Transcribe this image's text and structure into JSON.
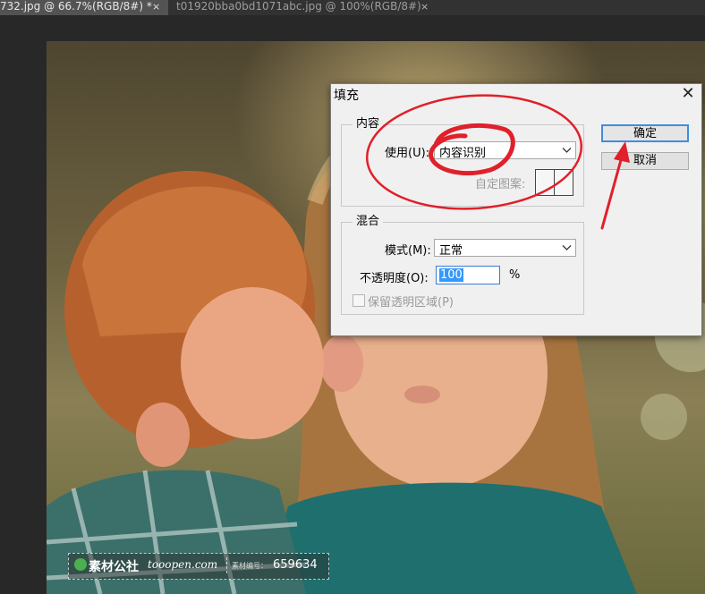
{
  "tabs": [
    {
      "label": "732.jpg @ 66.7%(RGB/8#) *",
      "close": "×"
    },
    {
      "label": "t01920bba0bd1071abc.jpg @ 100%(RGB/8#)",
      "close": "×"
    }
  ],
  "watermark": {
    "brand": "素材公社",
    "site": "tooopen.com",
    "id_label": "素材编号：",
    "id_value": "659634"
  },
  "dialog": {
    "title": "填充",
    "close": "✕",
    "content_group": {
      "legend": "内容",
      "use_label": "使用(U):",
      "use_value": "内容识别",
      "custom_pattern_label": "自定图案:"
    },
    "blend_group": {
      "legend": "混合",
      "mode_label": "模式(M):",
      "mode_value": "正常",
      "opacity_label": "不透明度(O):",
      "opacity_value": "100",
      "opacity_unit": "%",
      "preserve_transparency_label": "保留透明区域(P)",
      "preserve_transparency_checked": false
    },
    "ok_label": "确定",
    "cancel_label": "取消"
  },
  "annotations": {
    "color": "#e0202a"
  },
  "colors": {
    "app_background": "#282828",
    "dialog_background": "#f0f0f0",
    "accent": "#3d8ee0"
  }
}
